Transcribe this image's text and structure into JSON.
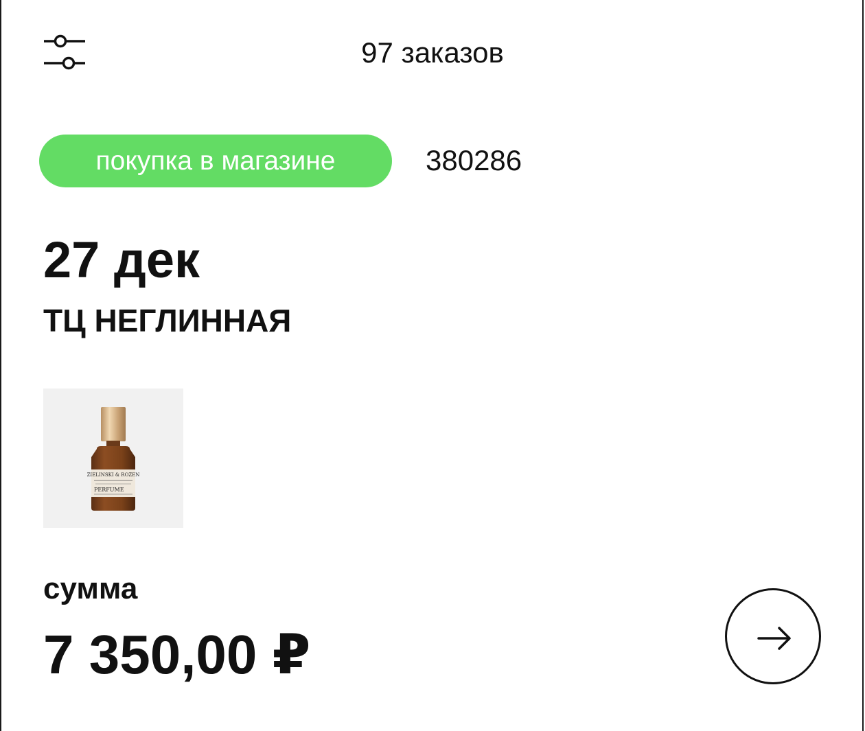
{
  "header": {
    "orders_count_label": "97 заказов",
    "filter_icon": "sliders-icon"
  },
  "order": {
    "badge_label": "покупка в магазине",
    "badge_color": "#63dc64",
    "number": "380286",
    "date": "27 дек",
    "store": "ТЦ НЕГЛИННАЯ",
    "product_image": {
      "icon": "perfume-bottle",
      "label_line1": "ZIELINSKI & ROZEN",
      "label_line2": "PERFUME"
    },
    "sum_label": "сумма",
    "sum_value": "7 350,00 ₽",
    "open_icon": "arrow-right-icon"
  }
}
